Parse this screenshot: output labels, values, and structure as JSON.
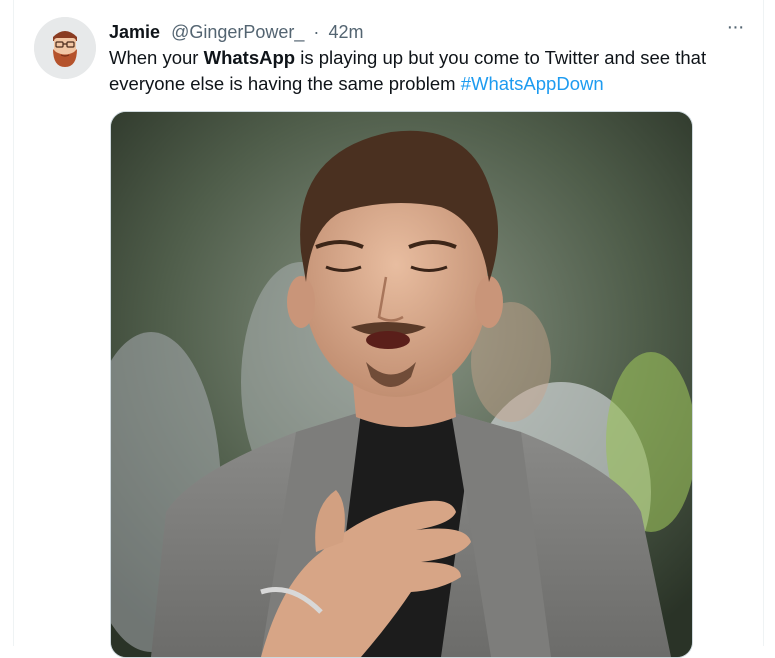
{
  "tweet": {
    "author_name": "Jamie",
    "handle": "@GingerPower_",
    "separator": "·",
    "time": "42m",
    "text_before": "When your ",
    "text_bold": "WhatsApp",
    "text_after": " is playing up but you come to Twitter and see that everyone else is having the same problem ",
    "hashtag": "#WhatsAppDown",
    "more_glyph": "···"
  },
  "media": {
    "alt": "Man in grey suit with eyes closed and hand on chest, looking relieved"
  },
  "colors": {
    "hashtag": "#1d9bf0",
    "secondary_text": "#536471",
    "primary_text": "#0f1419"
  }
}
